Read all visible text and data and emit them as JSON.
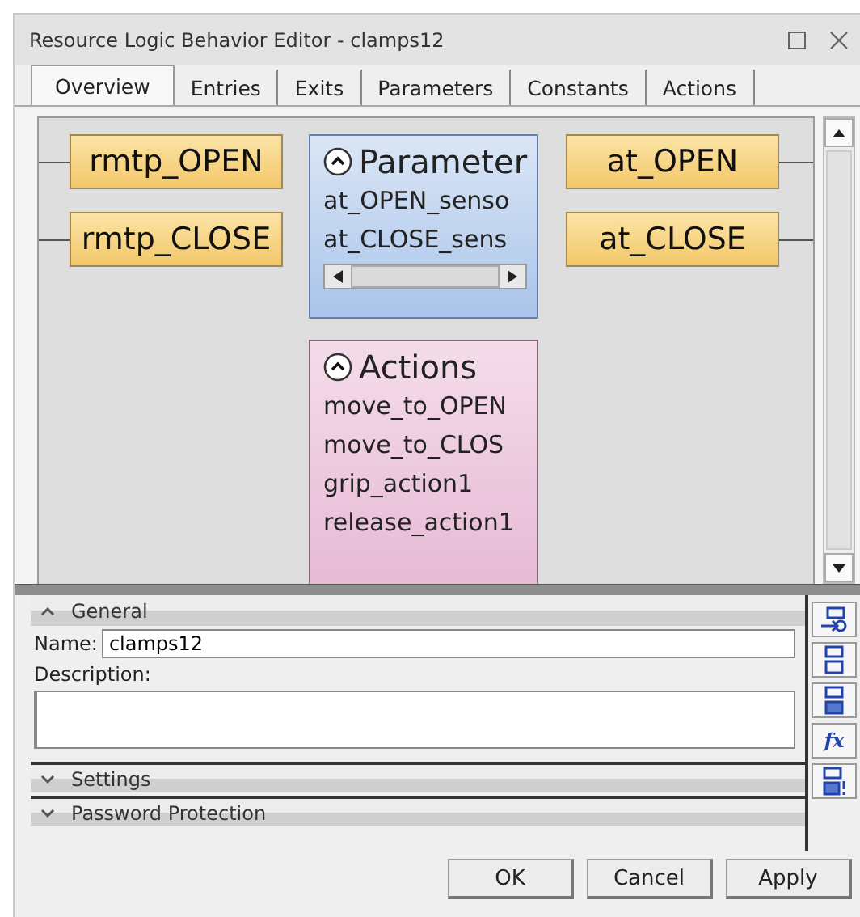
{
  "window": {
    "title": "Resource Logic Behavior Editor - clamps12"
  },
  "tabs": [
    {
      "label": "Overview",
      "selected": true
    },
    {
      "label": "Entries",
      "selected": false
    },
    {
      "label": "Exits",
      "selected": false
    },
    {
      "label": "Parameters",
      "selected": false
    },
    {
      "label": "Constants",
      "selected": false
    },
    {
      "label": "Actions",
      "selected": false
    }
  ],
  "diagram": {
    "entries": [
      "rmtp_OPEN",
      "rmtp_CLOSE"
    ],
    "exits": [
      "at_OPEN",
      "at_CLOSE"
    ],
    "parameter_box": {
      "title": "Parameter",
      "items": [
        "at_OPEN_senso",
        "at_CLOSE_sens"
      ]
    },
    "actions_box": {
      "title": "Actions",
      "items": [
        "move_to_OPEN",
        "move_to_CLOS",
        "grip_action1",
        "release_action1"
      ]
    }
  },
  "panels": [
    {
      "title": "General",
      "expanded": true
    },
    {
      "title": "Settings",
      "expanded": false
    },
    {
      "title": "Password Protection",
      "expanded": false
    }
  ],
  "general": {
    "name_label": "Name:",
    "name_value": "clamps12",
    "description_label": "Description:"
  },
  "toolbar": [
    {
      "kind": "arrow"
    },
    {
      "kind": "list"
    },
    {
      "kind": "grid"
    },
    {
      "kind": "function",
      "label": "fx"
    },
    {
      "kind": "alert"
    }
  ],
  "buttons": [
    "OK",
    "Cancel",
    "Apply"
  ]
}
